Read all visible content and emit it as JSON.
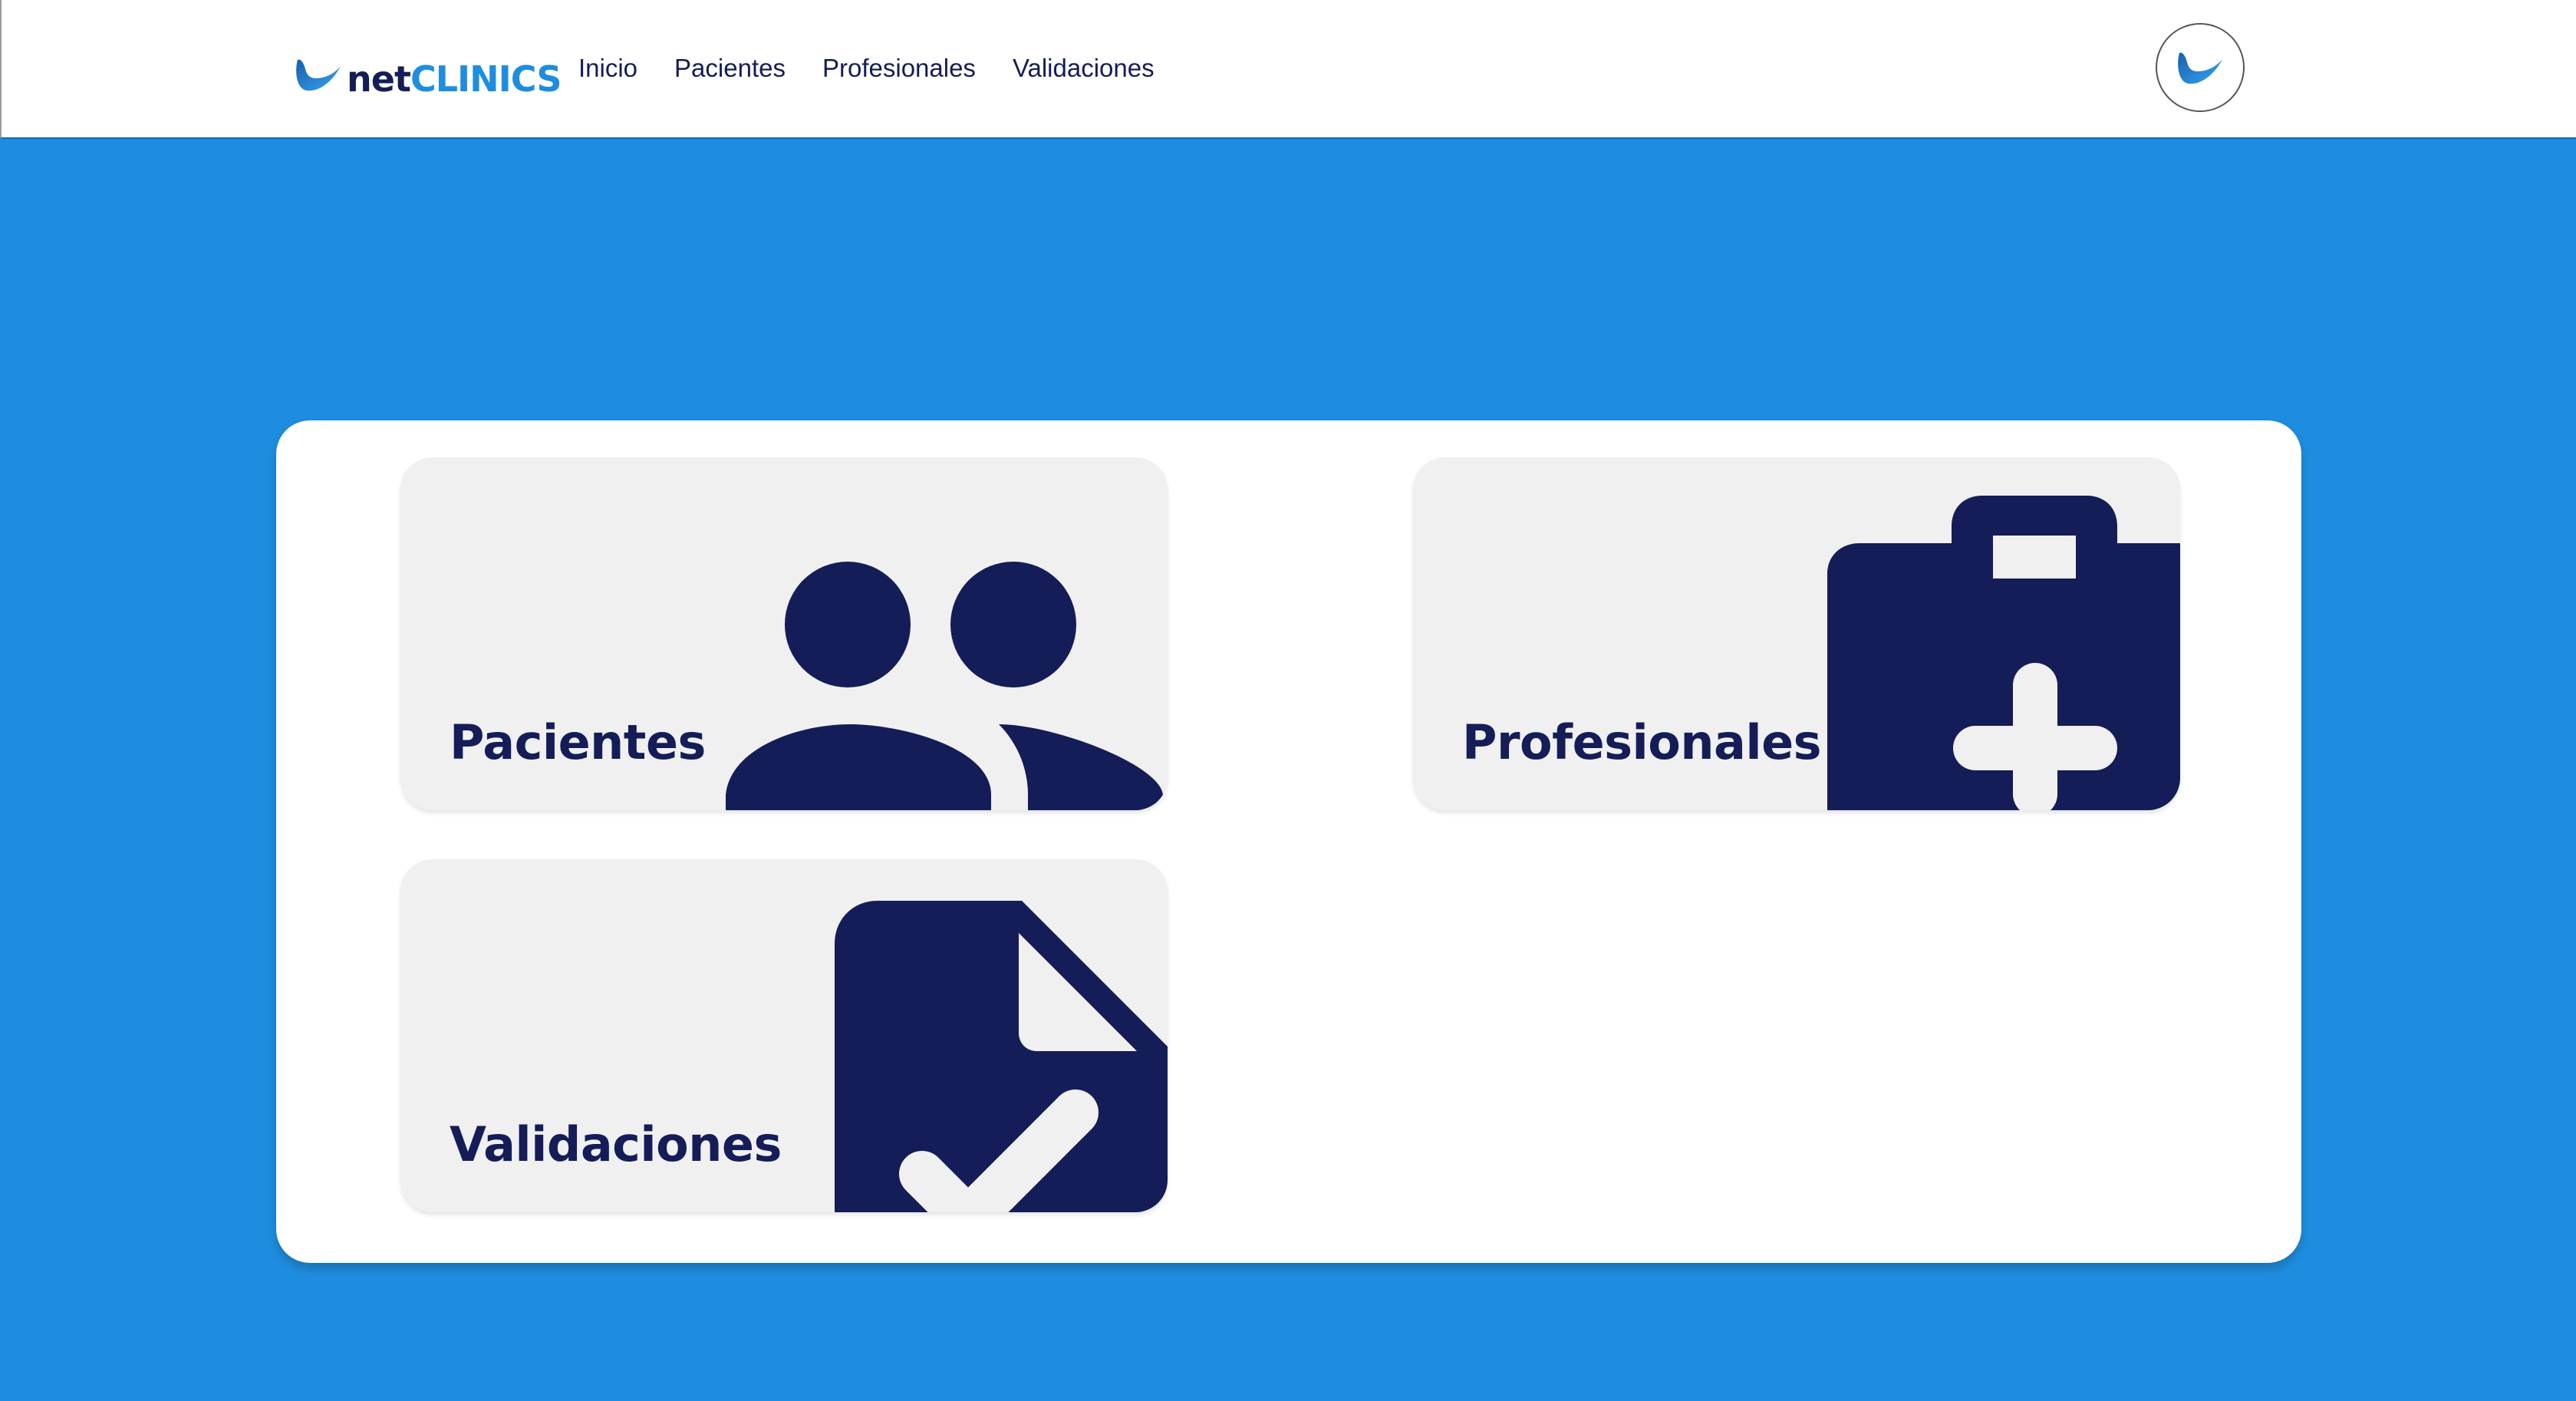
{
  "brand": {
    "name_part1": "net",
    "name_part2": "CLINICS"
  },
  "nav": {
    "items": [
      {
        "label": "Inicio"
      },
      {
        "label": "Pacientes"
      },
      {
        "label": "Profesionales"
      },
      {
        "label": "Validaciones"
      }
    ]
  },
  "user": {
    "avatar_icon": "netclinics-logo-icon"
  },
  "cards": [
    {
      "label": "Pacientes",
      "icon": "users-icon"
    },
    {
      "label": "Profesionales",
      "icon": "medical-briefcase-icon"
    },
    {
      "label": "Validaciones",
      "icon": "document-check-icon"
    }
  ],
  "colors": {
    "background": "#1f8ddf",
    "navy": "#141d57",
    "card": "#f0f0f0",
    "brand_blue": "#1f8ddf"
  }
}
